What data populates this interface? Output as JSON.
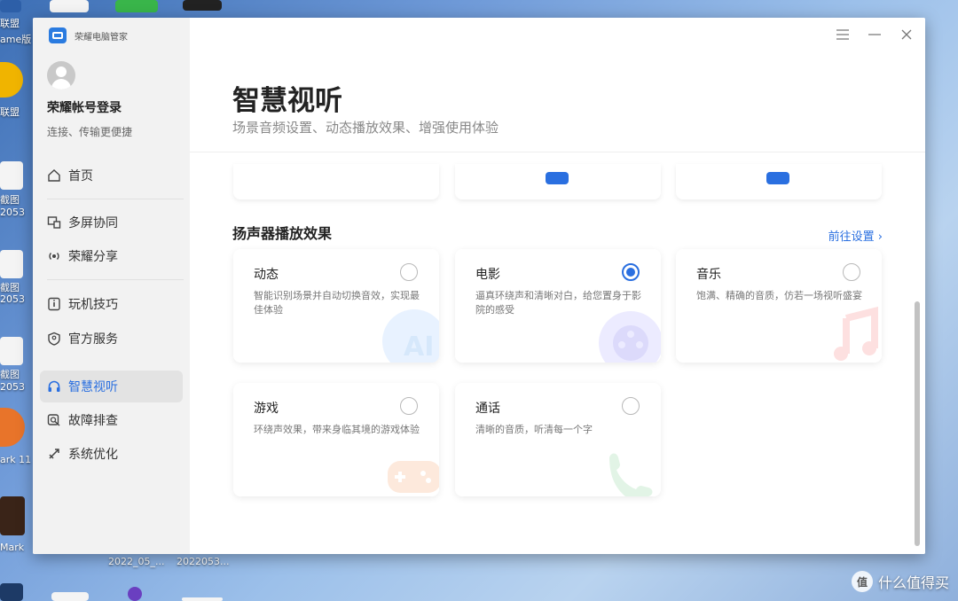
{
  "desktop": {
    "labels": [
      "联盟",
      "ame版",
      "联盟",
      "截图",
      "2053",
      "截图",
      "2053",
      "截图",
      "2053",
      "ark 11",
      "Mark",
      "2022_05_...",
      "2022053..."
    ],
    "watermark": "什么值得买",
    "watermark_badge": "值"
  },
  "app": {
    "title": "荣耀电脑管家",
    "window_controls": [
      "menu-icon",
      "minimize-icon",
      "close-icon"
    ]
  },
  "sidebar": {
    "account_name": "荣耀帐号登录",
    "account_sub": "连接、传输更便捷",
    "items": [
      {
        "label": "首页",
        "icon": "home-icon"
      },
      {
        "label": "多屏协同",
        "icon": "multi-screen-icon"
      },
      {
        "label": "荣耀分享",
        "icon": "share-icon"
      },
      {
        "label": "玩机技巧",
        "icon": "tips-icon"
      },
      {
        "label": "官方服务",
        "icon": "service-icon"
      },
      {
        "label": "智慧视听",
        "icon": "headphones-icon"
      },
      {
        "label": "故障排查",
        "icon": "troubleshoot-icon"
      },
      {
        "label": "系统优化",
        "icon": "optimize-icon"
      }
    ],
    "active_item": "智慧视听"
  },
  "main": {
    "title": "智慧视听",
    "subtitle": "场景音频设置、动态播放效果、增强使用体验",
    "section_title": "扬声器播放效果",
    "section_link": "前往设置",
    "cards": [
      {
        "title": "动态",
        "desc": "智能识别场景并自动切换音效，实现最佳体验",
        "checked": false,
        "art": "ai-art"
      },
      {
        "title": "电影",
        "desc": "逼真环绕声和清晰对白，给您置身于影院的感受",
        "checked": true,
        "art": "film-reel-art"
      },
      {
        "title": "音乐",
        "desc": "饱满、精确的音质，仿若一场视听盛宴",
        "checked": false,
        "art": "music-note-art"
      },
      {
        "title": "游戏",
        "desc": "环绕声效果，带来身临其境的游戏体验",
        "checked": false,
        "art": "gamepad-art"
      },
      {
        "title": "通话",
        "desc": "清晰的音质，听清每一个字",
        "checked": false,
        "art": "phone-art"
      }
    ],
    "colors": {
      "accent": "#2a6fe0",
      "sidebar_bg": "#f2f2f2"
    }
  }
}
